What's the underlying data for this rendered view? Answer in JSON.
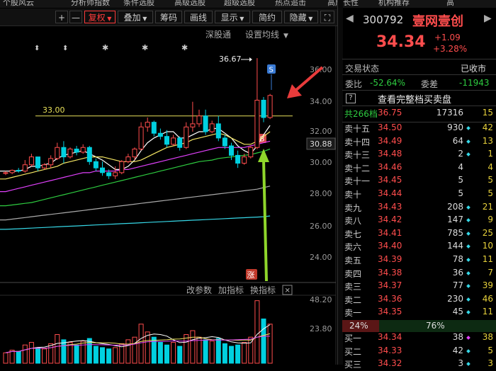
{
  "menu": [
    "个股风云",
    "分析师指数",
    "条件选股",
    "高级选股",
    "超级选股",
    "热点追击",
    "高成长性",
    "机构推荐",
    "高"
  ],
  "toolbar": {
    "plus": "+",
    "minus": "—",
    "fuquan": "复权",
    "diejia": "叠加",
    "chouma": "筹码",
    "huaxian": "画线",
    "xianshi": "显示",
    "jianyue": "简约",
    "yincang": "隐藏",
    "expand": "⛶"
  },
  "chart": {
    "links": {
      "shenguton": "深股通",
      "shezhi": "设置均线"
    },
    "max_label": "36.67",
    "ref_line_label": "33.00",
    "s_badge": "S",
    "b_badge": "B",
    "zhang_badge": "涨",
    "price_axis": [
      "36.00",
      "34.00",
      "32.00",
      "30.88",
      "30.00",
      "28.00",
      "26.00",
      "24.00"
    ],
    "sub_toolbar": {
      "gai": "改参数",
      "jia": "加指标",
      "huan": "换指标",
      "close": "✕"
    },
    "vol_axis": [
      "48.20",
      "23.80"
    ],
    "candles": [
      [
        29.35,
        29.5,
        29.25,
        29.4
      ],
      [
        29.4,
        29.6,
        29.3,
        29.55
      ],
      [
        29.55,
        29.7,
        29.4,
        29.5
      ],
      [
        29.5,
        30.2,
        29.4,
        29.9
      ],
      [
        29.9,
        30.6,
        29.8,
        30.4
      ],
      [
        30.4,
        30.3,
        29.5,
        29.7
      ],
      [
        29.7,
        30.0,
        29.6,
        29.9
      ],
      [
        29.9,
        30.5,
        29.7,
        30.3
      ],
      [
        30.3,
        31.3,
        30.2,
        31.0
      ],
      [
        31.0,
        31.4,
        30.0,
        30.4
      ],
      [
        30.4,
        31.0,
        30.3,
        30.9
      ],
      [
        30.9,
        31.1,
        30.5,
        30.7
      ],
      [
        30.7,
        31.2,
        30.6,
        31.0
      ],
      [
        31.0,
        31.1,
        29.9,
        30.1
      ],
      [
        30.1,
        30.3,
        29.5,
        29.7
      ],
      [
        29.7,
        30.1,
        29.2,
        29.4
      ],
      [
        29.4,
        29.6,
        29.0,
        29.2
      ],
      [
        29.2,
        29.8,
        29.0,
        29.4
      ],
      [
        29.4,
        30.2,
        29.3,
        30.1
      ],
      [
        30.1,
        30.6,
        30.0,
        30.4
      ],
      [
        30.4,
        31.0,
        30.2,
        30.9
      ],
      [
        30.9,
        32.6,
        30.8,
        32.3
      ],
      [
        32.3,
        32.9,
        32.0,
        32.6
      ],
      [
        32.6,
        32.7,
        31.7,
        31.9
      ],
      [
        31.9,
        32.2,
        31.5,
        31.7
      ],
      [
        31.7,
        32.1,
        31.0,
        31.2
      ],
      [
        31.2,
        31.8,
        31.1,
        31.6
      ],
      [
        31.6,
        31.7,
        30.8,
        31.0
      ],
      [
        31.0,
        32.6,
        30.9,
        32.3
      ],
      [
        32.3,
        33.9,
        32.0,
        32.5
      ],
      [
        32.5,
        33.4,
        32.3,
        33.0
      ],
      [
        33.0,
        33.4,
        31.8,
        32.0
      ],
      [
        32.0,
        32.7,
        31.9,
        32.5
      ],
      [
        32.5,
        33.0,
        31.4,
        31.6
      ],
      [
        31.6,
        31.8,
        30.9,
        31.1
      ],
      [
        31.1,
        31.3,
        30.2,
        30.5
      ],
      [
        30.5,
        30.8,
        29.7,
        30.0
      ],
      [
        30.0,
        30.6,
        29.9,
        30.4
      ],
      [
        30.4,
        31.1,
        30.3,
        31.0
      ],
      [
        31.0,
        36.67,
        30.9,
        34.0
      ],
      [
        34.0,
        34.2,
        32.6,
        32.9
      ],
      [
        32.9,
        34.4,
        32.8,
        34.3
      ]
    ],
    "ma": [
      {
        "color": "#ffffff",
        "values": [
          29.5,
          29.5,
          29.5,
          29.6,
          29.8,
          29.8,
          29.9,
          30.0,
          30.3,
          30.5,
          30.6,
          30.7,
          30.8,
          30.6,
          30.4,
          30.2,
          29.9,
          29.6,
          29.6,
          29.8,
          30.2,
          30.8,
          31.3,
          31.6,
          31.8,
          32.0,
          32.0,
          31.6,
          31.6,
          31.8,
          32.0,
          32.0,
          32.2,
          32.2,
          31.9,
          31.6,
          31.1,
          30.8,
          30.6,
          31.1,
          31.8,
          32.4
        ]
      },
      {
        "color": "#f5e663",
        "values": [
          29.0,
          29.1,
          29.2,
          29.3,
          29.4,
          29.5,
          29.6,
          29.7,
          29.8,
          30.0,
          30.1,
          30.2,
          30.3,
          30.4,
          30.4,
          30.4,
          30.3,
          30.2,
          30.1,
          30.1,
          30.1,
          30.2,
          30.4,
          30.6,
          30.8,
          31.0,
          31.1,
          31.2,
          31.3,
          31.5,
          31.6,
          31.7,
          31.8,
          31.9,
          31.8,
          31.6,
          31.4,
          31.2,
          31.2,
          31.4,
          31.7,
          32.0
        ]
      },
      {
        "color": "#e040fb",
        "values": [
          28.2,
          28.3,
          28.4,
          28.5,
          28.6,
          28.7,
          28.8,
          28.9,
          29.0,
          29.1,
          29.2,
          29.3,
          29.4,
          29.4,
          29.5,
          29.5,
          29.5,
          29.5,
          29.6,
          29.6,
          29.7,
          29.8,
          29.9,
          30.0,
          30.1,
          30.2,
          30.3,
          30.4,
          30.5,
          30.6,
          30.7,
          30.8,
          30.9,
          31.0,
          31.0,
          31.0,
          31.0,
          31.0,
          31.1,
          31.2,
          31.3,
          31.4
        ]
      },
      {
        "color": "#2ecc40",
        "values": [
          27.3,
          27.35,
          27.4,
          27.45,
          27.5,
          27.6,
          27.7,
          27.8,
          27.9,
          28.0,
          28.1,
          28.2,
          28.3,
          28.4,
          28.5,
          28.6,
          28.7,
          28.8,
          28.9,
          29.0,
          29.1,
          29.2,
          29.3,
          29.4,
          29.5,
          29.6,
          29.7,
          29.8,
          29.9,
          30.0,
          30.1,
          30.15,
          30.2,
          30.3,
          30.35,
          30.4,
          30.45,
          30.5,
          30.55,
          30.65,
          30.75,
          30.9
        ]
      },
      {
        "color": "#aaaaaa",
        "values": [
          26.4,
          26.45,
          26.5,
          26.55,
          26.6,
          26.65,
          26.7,
          26.75,
          26.8,
          26.85,
          26.9,
          26.95,
          27.0,
          27.05,
          27.1,
          27.15,
          27.2,
          27.25,
          27.3,
          27.35,
          27.4,
          27.45,
          27.5,
          27.55,
          27.6,
          27.65,
          27.7,
          27.75,
          27.8,
          27.85,
          27.9,
          27.95,
          28.0,
          28.05,
          28.1,
          28.15,
          28.2,
          28.25,
          28.3,
          28.35,
          28.45,
          28.55
        ]
      },
      {
        "color": "#36d7e6",
        "values": [
          25.8,
          25.82,
          25.84,
          25.86,
          25.88,
          25.9,
          25.92,
          25.94,
          25.96,
          25.98,
          26.0,
          26.02,
          26.04,
          26.06,
          26.08,
          26.1,
          26.12,
          26.14,
          26.16,
          26.18,
          26.2,
          26.22,
          26.24,
          26.26,
          26.28,
          26.3,
          26.32,
          26.34,
          26.36,
          26.38,
          26.4,
          26.42,
          26.44,
          26.46,
          26.48,
          26.5,
          26.52,
          26.54,
          26.56,
          26.58,
          26.6,
          26.65
        ]
      }
    ],
    "volumes": [
      8,
      10,
      9,
      14,
      16,
      12,
      11,
      15,
      22,
      18,
      16,
      14,
      17,
      19,
      13,
      12,
      11,
      12,
      15,
      18,
      20,
      30,
      24,
      20,
      16,
      14,
      16,
      13,
      22,
      25,
      20,
      18,
      17,
      19,
      15,
      13,
      14,
      16,
      20,
      48,
      34,
      30
    ]
  },
  "quote": {
    "code": "300792",
    "name": "壹网壹创",
    "price": "34.34",
    "change": "+1.09",
    "change_pct": "+3.28%",
    "trade_status_label": "交易状态",
    "trade_status": "已收市",
    "weibi_label": "委比",
    "weibi": "-52.64%",
    "weicha_label": "委差",
    "weicha": "-11943",
    "full_book_icon": "?",
    "full_book": "查看完整档买卖盘",
    "summary_label": "共266档",
    "summary_price": "36.75",
    "summary_vol": "17316",
    "summary_cnt": "15",
    "asks": [
      {
        "label": "卖十五",
        "price": "34.50",
        "vol": "930",
        "cnt": "42",
        "dot": true
      },
      {
        "label": "卖十四",
        "price": "34.49",
        "vol": "64",
        "cnt": "13",
        "dot": true
      },
      {
        "label": "卖十三",
        "price": "34.48",
        "vol": "2",
        "cnt": "1",
        "dot": true
      },
      {
        "label": "卖十二",
        "price": "34.46",
        "vol": "4",
        "cnt": "4",
        "dot": false
      },
      {
        "label": "卖十一",
        "price": "34.45",
        "vol": "5",
        "cnt": "5",
        "dot": false
      },
      {
        "label": "卖十",
        "price": "34.44",
        "vol": "5",
        "cnt": "5",
        "dot": false
      },
      {
        "label": "卖九",
        "price": "34.43",
        "vol": "208",
        "cnt": "21",
        "dot": true
      },
      {
        "label": "卖八",
        "price": "34.42",
        "vol": "147",
        "cnt": "9",
        "dot": true
      },
      {
        "label": "卖七",
        "price": "34.41",
        "vol": "785",
        "cnt": "25",
        "dot": true
      },
      {
        "label": "卖六",
        "price": "34.40",
        "vol": "144",
        "cnt": "10",
        "dot": true
      },
      {
        "label": "卖五",
        "price": "34.39",
        "vol": "78",
        "cnt": "11",
        "dot": true
      },
      {
        "label": "卖四",
        "price": "34.38",
        "vol": "36",
        "cnt": "7",
        "dot": true
      },
      {
        "label": "卖三",
        "price": "34.37",
        "vol": "77",
        "cnt": "39",
        "dot": true
      },
      {
        "label": "卖二",
        "price": "34.36",
        "vol": "230",
        "cnt": "46",
        "dot": true
      },
      {
        "label": "卖一",
        "price": "34.35",
        "vol": "45",
        "cnt": "11",
        "dot": true
      }
    ],
    "ratio_left": "24%",
    "ratio_right": "76%",
    "bids": [
      {
        "label": "买一",
        "price": "34.34",
        "vol": "38",
        "cnt": "38",
        "dot": "m"
      },
      {
        "label": "买二",
        "price": "34.33",
        "vol": "42",
        "cnt": "5",
        "dot": "c"
      },
      {
        "label": "买三",
        "price": "34.32",
        "vol": "3",
        "cnt": "3",
        "dot": "c"
      }
    ]
  },
  "colors": {
    "up": "#ff4d4d",
    "down": "#00d0e0",
    "ref": "#e8e05a"
  }
}
